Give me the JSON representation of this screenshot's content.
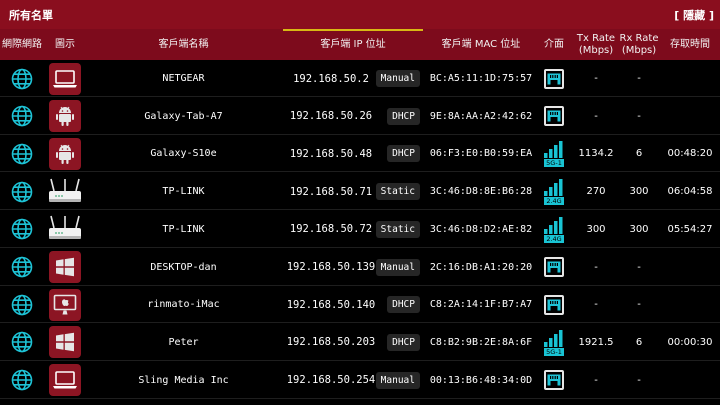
{
  "header": {
    "title": "所有名單",
    "hide_label": "[ 隱藏 ]"
  },
  "columns": {
    "network": "網際網路",
    "icon": "圖示",
    "name": "客戶端名稱",
    "ip": "客戶端 IP 位址",
    "mac": "客戶端 MAC 位址",
    "interface": "介面",
    "tx": "Tx Rate\n(Mbps)",
    "rx": "Rx Rate\n(Mbps)",
    "time": "存取時間"
  },
  "colors": {
    "title_bar": "#8a0e1e",
    "header_bar": "#7d0b1c",
    "device_icon_bg": "#8c1523",
    "globe": "#1ec3d6",
    "wifi": "#19c4d4",
    "sort_indicator": "#d8b814"
  },
  "rows": [
    {
      "device_icon": "laptop-icon",
      "name": "NETGEAR",
      "ip": "192.168.50.2",
      "ip_type": "Manual",
      "mac": "BC:A5:11:1D:75:57",
      "interface": "ethernet-icon",
      "tx": "-",
      "rx": "-",
      "time": ""
    },
    {
      "device_icon": "android-icon",
      "name": "Galaxy-Tab-A7",
      "ip": "192.168.50.26",
      "ip_type": "DHCP",
      "mac": "9E:8A:AA:A2:42:62",
      "interface": "ethernet-icon",
      "tx": "-",
      "rx": "-",
      "time": ""
    },
    {
      "device_icon": "android-icon",
      "name": "Galaxy-S10e",
      "ip": "192.168.50.48",
      "ip_type": "DHCP",
      "mac": "06:F3:E0:B0:59:EA",
      "interface": "wifi-icon",
      "band": "5G-1",
      "tx": "1134.2",
      "rx": "6",
      "time": "00:48:20"
    },
    {
      "device_icon": "router-icon",
      "name": "TP-LINK",
      "ip": "192.168.50.71",
      "ip_type": "Static",
      "mac": "3C:46:D8:8E:B6:28",
      "interface": "wifi-icon",
      "band": "2.4G",
      "tx": "270",
      "rx": "300",
      "time": "06:04:58"
    },
    {
      "device_icon": "router-icon",
      "name": "TP-LINK",
      "ip": "192.168.50.72",
      "ip_type": "Static",
      "mac": "3C:46:D8:D2:AE:82",
      "interface": "wifi-icon",
      "band": "2.4G",
      "tx": "300",
      "rx": "300",
      "time": "05:54:27"
    },
    {
      "device_icon": "windows-icon",
      "name": "DESKTOP-dan",
      "ip": "192.168.50.139",
      "ip_type": "Manual",
      "mac": "2C:16:DB:A1:20:20",
      "interface": "ethernet-icon",
      "tx": "-",
      "rx": "-",
      "time": ""
    },
    {
      "device_icon": "imac-icon",
      "name": "rinmato-iMac",
      "ip": "192.168.50.140",
      "ip_type": "DHCP",
      "mac": "C8:2A:14:1F:B7:A7",
      "interface": "ethernet-icon",
      "tx": "-",
      "rx": "-",
      "time": ""
    },
    {
      "device_icon": "windows-icon",
      "name": "Peter",
      "ip": "192.168.50.203",
      "ip_type": "DHCP",
      "mac": "C8:B2:9B:2E:8A:6F",
      "interface": "wifi-icon",
      "band": "5G-1",
      "tx": "1921.5",
      "rx": "6",
      "time": "00:00:30"
    },
    {
      "device_icon": "laptop-icon",
      "name": "Sling Media Inc",
      "ip": "192.168.50.254",
      "ip_type": "Manual",
      "mac": "00:13:B6:48:34:0D",
      "interface": "ethernet-icon",
      "tx": "-",
      "rx": "-",
      "time": ""
    }
  ]
}
